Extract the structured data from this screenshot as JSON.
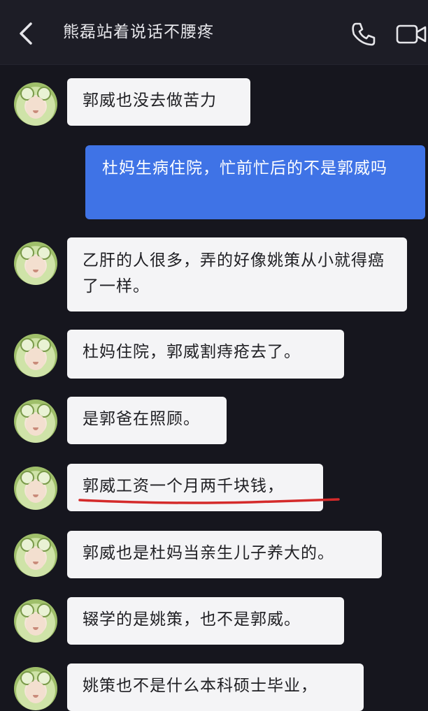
{
  "header": {
    "title": "熊磊站着说话不腰疼"
  },
  "messages": [
    {
      "from": "other",
      "text": "郭威也没去做苦力"
    },
    {
      "from": "me",
      "text": "杜妈生病住院，忙前忙后的不是郭威吗"
    },
    {
      "from": "other",
      "text": "乙肝的人很多，弄的好像姚策从小就得癌了一样。"
    },
    {
      "from": "other",
      "text": "杜妈住院，郭威割痔疮去了。"
    },
    {
      "from": "other",
      "text": "是郭爸在照顾。"
    },
    {
      "from": "other",
      "text": "郭威工资一个月两千块钱，"
    },
    {
      "from": "other",
      "text": "郭威也是杜妈当亲生儿子养大的。"
    },
    {
      "from": "other",
      "text": "辍学的是姚策，也不是郭威。"
    },
    {
      "from": "other",
      "text": "姚策也不是什么本科硕士毕业，"
    }
  ],
  "colors": {
    "background": "#16161e",
    "sent_bubble": "#3f73e6",
    "received_bubble": "#f4f4f6",
    "annotation": "#d42a2a"
  },
  "icons": {
    "back": "chevron-left-icon",
    "call": "phone-icon",
    "video": "video-camera-icon"
  }
}
